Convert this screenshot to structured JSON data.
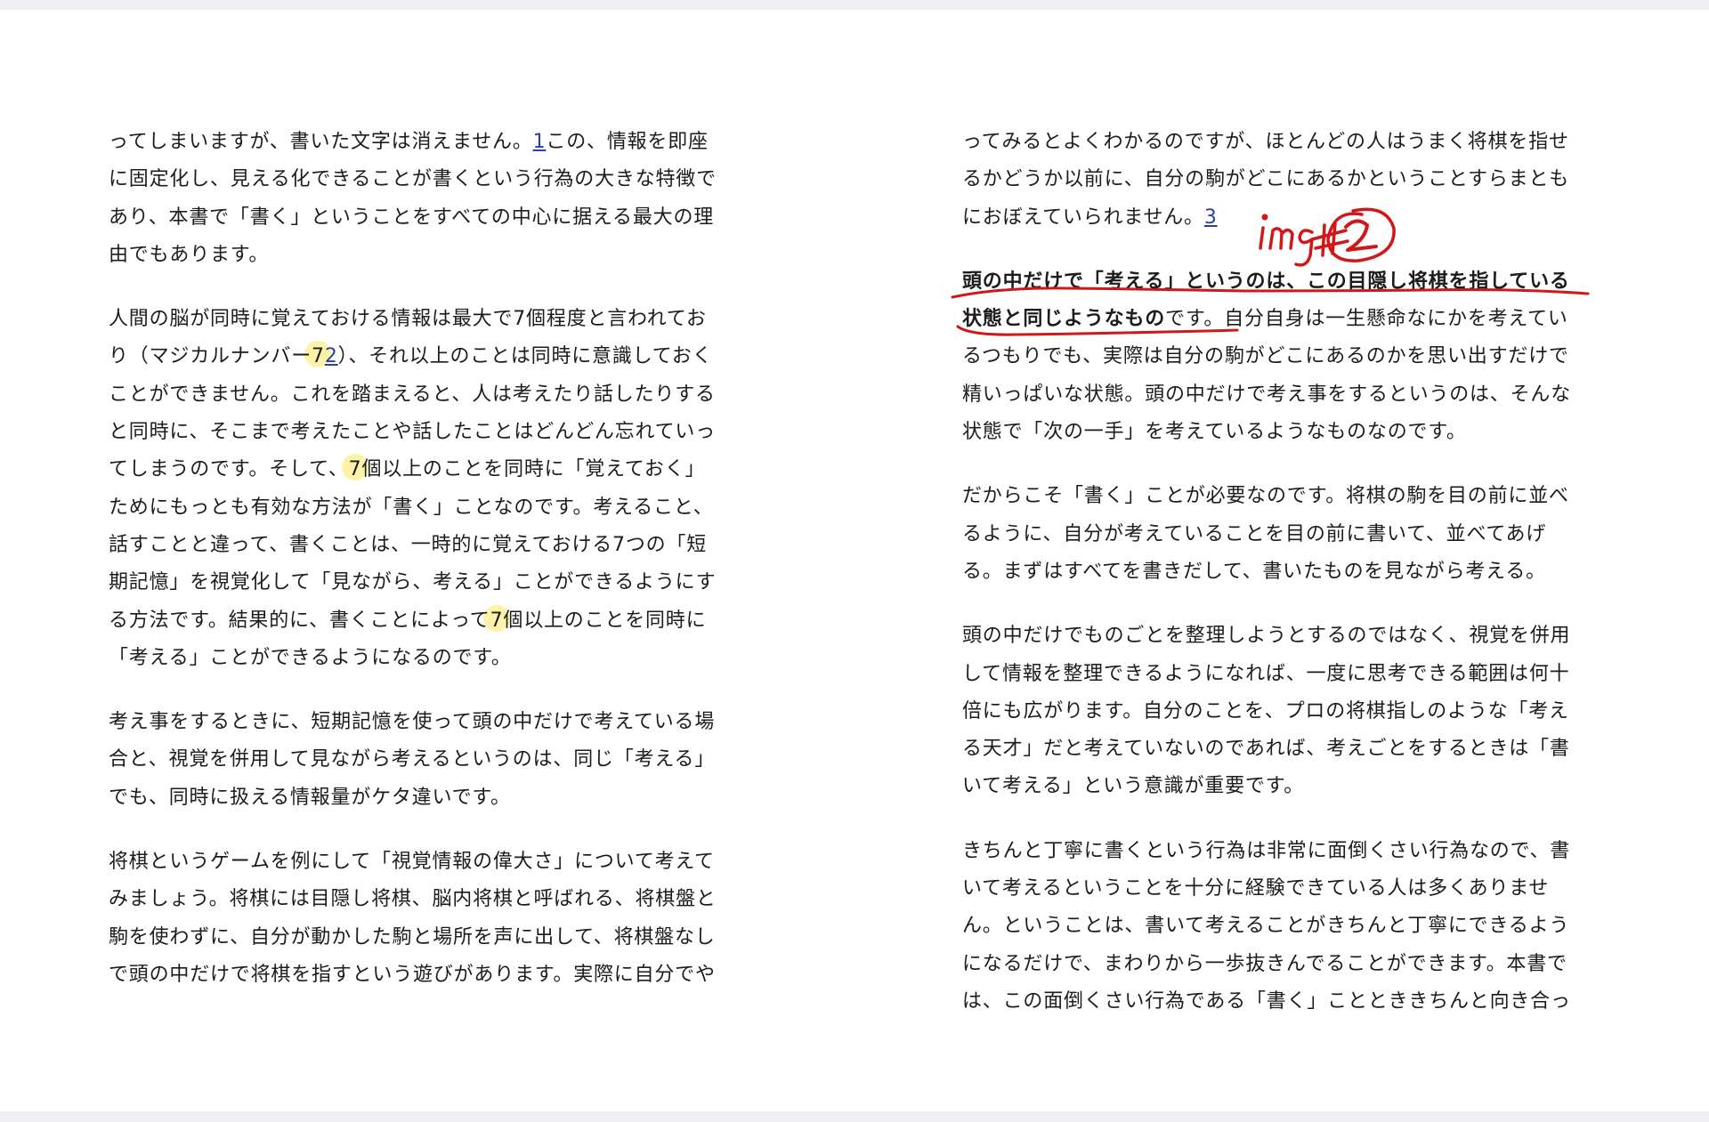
{
  "left_page": {
    "p1": {
      "l1a": "ってしまいますが、書いた文字は消えません。",
      "l1_fn": "1",
      "l1b": "この、情報を即座",
      "l2": "に固定化し、見える化できることが書くという行為の大きな特徴で",
      "l3": "あり、本書で「書く」ということをすべての中心に据える最大の理",
      "l4": "由でもあります。"
    },
    "p2": {
      "l1": "人間の脳が同時に覚えておける情報は最大で7個程度と言われてお",
      "l2a": "り（マジカルナンバー",
      "l2_hl": "7",
      "l2_fn": "2",
      "l2b": "）、それ以上のことは同時に意識しておく",
      "l3": "ことができません。これを踏まえると、人は考えたり話したりする",
      "l4": "と同時に、そこまで考えたことや話したことはどんどん忘れていっ",
      "l5a": "てしまうのです。そして、",
      "l5_hl": "7",
      "l5b": "個以上のことを同時に「覚えておく」",
      "l6": "ためにもっとも有効な方法が「書く」ことなのです。考えること、",
      "l7": "話すことと違って、書くことは、一時的に覚えておける7つの「短",
      "l8": "期記憶」を視覚化して「見ながら、考える」ことができるようにす",
      "l9a": "る方法です。結果的に、書くことによって",
      "l9_hl": "7",
      "l9b": "個以上のことを同時に",
      "l10": "「考える」ことができるようになるのです。"
    },
    "p3": {
      "l1": "考え事をするときに、短期記憶を使って頭の中だけで考えている場",
      "l2": "合と、視覚を併用して見ながら考えるというのは、同じ「考える」",
      "l3": "でも、同時に扱える情報量がケタ違いです。"
    },
    "p4": {
      "l1": "将棋というゲームを例にして「視覚情報の偉大さ」について考えて",
      "l2": "みましょう。将棋には目隠し将棋、脳内将棋と呼ばれる、将棋盤と",
      "l3": "駒を使わずに、自分が動かした駒と場所を声に出して、将棋盤なし",
      "l4": "で頭の中だけで将棋を指すという遊びがあります。実際に自分でや"
    }
  },
  "right_page": {
    "p1": {
      "l1": "ってみるとよくわかるのですが、ほとんどの人はうまく将棋を指せ",
      "l2": "るかどうか以前に、自分の駒がどこにあるかということすらまとも",
      "l3a": "におぼえていられません。",
      "l3_fn": "3"
    },
    "p2": {
      "l1_bold": "頭の中だけで「考える」というのは、この目隠し将棋を指している",
      "l2_bold": "状態と同じようなもの",
      "l2b": "です。自分自身は一生懸命なにかを考えてい",
      "l3": "るつもりでも、実際は自分の駒がどこにあるのかを思い出すだけで",
      "l4": "精いっぱいな状態。頭の中だけで考え事をするというのは、そんな",
      "l5": "状態で「次の一手」を考えているようなものなのです。"
    },
    "p3": {
      "l1": "だからこそ「書く」ことが必要なのです。将棋の駒を目の前に並べ",
      "l2": "るように、自分が考えていることを目の前に書いて、並べてあげ",
      "l3": "る。まずはすべてを書きだして、書いたものを見ながら考える。"
    },
    "p4": {
      "l1": "頭の中だけでものごとを整理しようとするのではなく、視覚を併用",
      "l2": "して情報を整理できるようになれば、一度に思考できる範囲は何十",
      "l3": "倍にも広がります。自分のことを、プロの将棋指しのような「考え",
      "l4": "る天才」だと考えていないのであれば、考えごとをするときは「書",
      "l5": "いて考える」という意識が重要です。"
    },
    "p5": {
      "l1": "きちんと丁寧に書くという行為は非常に面倒くさい行為なので、書",
      "l2": "いて考えるということを十分に経験できている人は多くありませ",
      "l3": "ん。ということは、書いて考えることがきちんと丁寧にできるよう",
      "l4": "になるだけで、まわりから一歩抜きんでることができます。本書で",
      "l5": "は、この面倒くさい行為である「書く」こととききちんと向き合っ"
    }
  },
  "annotation": {
    "color": "#d01818",
    "marker_color": "#fbf19a",
    "handwritten_note": "img#2"
  }
}
